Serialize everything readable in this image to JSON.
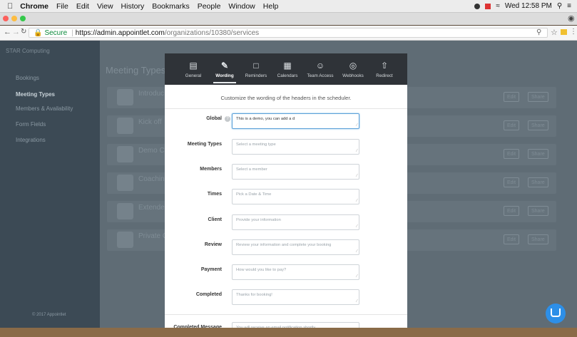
{
  "menubar": {
    "items": [
      "Chrome",
      "File",
      "Edit",
      "View",
      "History",
      "Bookmarks",
      "People",
      "Window",
      "Help"
    ],
    "clock": "Wed 12:58 PM"
  },
  "browser": {
    "secure_label": "Secure",
    "url_host": "https://admin.appointlet.com",
    "url_path": "/organizations/10380/services"
  },
  "sidebar": {
    "org": "STAR Computing",
    "items": [
      "Bookings",
      "Meeting Types",
      "Members & Availability",
      "Form Fields",
      "Integrations"
    ],
    "active_index": 1,
    "footer": "© 2017 Appointlet"
  },
  "main": {
    "title": "Meeting Types",
    "cards": [
      {
        "title": "Introduc"
      },
      {
        "title": "Kick off"
      },
      {
        "title": "Demo C"
      },
      {
        "title": "Coachin"
      },
      {
        "title": "Extende"
      },
      {
        "title": "Private C"
      }
    ],
    "edit_label": "Edit",
    "share_label": "Share"
  },
  "modal": {
    "tabs": [
      {
        "label": "General",
        "icon": "document-icon"
      },
      {
        "label": "Wording",
        "icon": "edit-icon"
      },
      {
        "label": "Reminders",
        "icon": "bell-icon"
      },
      {
        "label": "Calendars",
        "icon": "calendar-icon"
      },
      {
        "label": "Team Access",
        "icon": "people-icon"
      },
      {
        "label": "Webhooks",
        "icon": "webhook-icon"
      },
      {
        "label": "Redirect",
        "icon": "redirect-icon"
      }
    ],
    "active_tab": "Wording",
    "subtitle": "Customize the wording of the headers in the scheduler.",
    "fields": [
      {
        "label": "Global",
        "value": "This is a demo, you can add a d",
        "placeholder": ""
      },
      {
        "label": "Meeting Types",
        "value": "",
        "placeholder": "Select a meeting type"
      },
      {
        "label": "Members",
        "value": "",
        "placeholder": "Select a member"
      },
      {
        "label": "Times",
        "value": "",
        "placeholder": "Pick a Date & Time"
      },
      {
        "label": "Client",
        "value": "",
        "placeholder": "Provide your information"
      },
      {
        "label": "Review",
        "value": "",
        "placeholder": "Review your information and complete your booking"
      },
      {
        "label": "Payment",
        "value": "",
        "placeholder": "How would you like to pay?"
      },
      {
        "label": "Completed",
        "value": "",
        "placeholder": "Thanks for booking!"
      },
      {
        "label": "Completed Message",
        "value": "",
        "placeholder": "You will receive an email notification shortly."
      }
    ]
  },
  "colors": {
    "modal_nav_bg": "#2f3338",
    "focus_border": "#5aa0d8",
    "chat_button": "#2d8fe8"
  }
}
